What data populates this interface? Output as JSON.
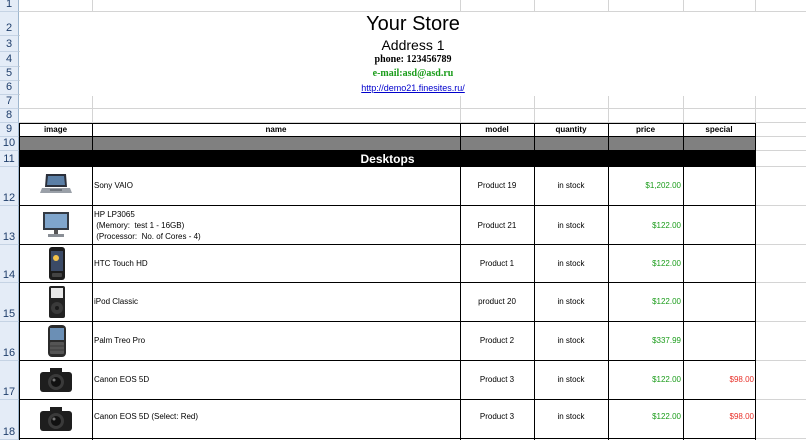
{
  "store": {
    "title": "Your Store",
    "address": "Address 1",
    "phone": "phone: 123456789",
    "email": "e-mail:asd@asd.ru",
    "url": "http://demo21.finesites.ru/"
  },
  "row_numbers": [
    "1",
    "2",
    "3",
    "4",
    "5",
    "6",
    "7",
    "8",
    "9",
    "10",
    "11",
    "12",
    "13",
    "14",
    "15",
    "16",
    "17",
    "18"
  ],
  "table": {
    "headers": [
      "image",
      "name",
      "model",
      "quantity",
      "price",
      "special"
    ],
    "category": "Desktops",
    "rows": [
      {
        "name_lines": [
          "Sony VAIO"
        ],
        "model": "Product 19",
        "quantity": "in stock",
        "price": "$1,202.00",
        "special": "",
        "icon": "laptop-icon"
      },
      {
        "name_lines": [
          "HP LP3065",
          " (Memory:  test 1 - 16GB)",
          " (Processor:  No. of Cores - 4)"
        ],
        "model": "Product 21",
        "quantity": "in stock",
        "price": "$122.00",
        "special": "",
        "icon": "monitor-icon"
      },
      {
        "name_lines": [
          "HTC Touch HD"
        ],
        "model": "Product 1",
        "quantity": "in stock",
        "price": "$122.00",
        "special": "",
        "icon": "smartphone-icon"
      },
      {
        "name_lines": [
          "iPod Classic"
        ],
        "model": "product 20",
        "quantity": "in stock",
        "price": "$122.00",
        "special": "",
        "icon": "ipod-icon"
      },
      {
        "name_lines": [
          "Palm Treo Pro"
        ],
        "model": "Product 2",
        "quantity": "in stock",
        "price": "$337.99",
        "special": "",
        "icon": "palm-phone-icon"
      },
      {
        "name_lines": [
          "Canon EOS 5D"
        ],
        "model": "Product 3",
        "quantity": "in stock",
        "price": "$122.00",
        "special": "$98.00",
        "icon": "camera-icon"
      },
      {
        "name_lines": [
          "Canon EOS 5D (Select: Red)"
        ],
        "model": "Product 3",
        "quantity": "in stock",
        "price": "$122.00",
        "special": "$98.00",
        "icon": "camera-icon"
      }
    ]
  },
  "colors": {
    "price": "#1a9c1a",
    "special": "#e8312a",
    "email": "#1a9c1a",
    "link": "#0000cc",
    "header_bg": "#e4ecf7",
    "grey_row": "#808080",
    "category_bg": "#000000"
  }
}
